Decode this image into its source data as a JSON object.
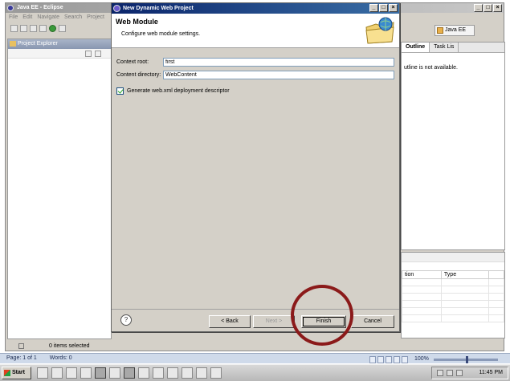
{
  "eclipse": {
    "title": "Java EE - Eclipse",
    "menu": [
      "File",
      "Edit",
      "Navigate",
      "Search",
      "Project"
    ],
    "perspective_label": "Java EE",
    "project_explorer_tab": "Project Explorer",
    "outline_tab": "Outline",
    "task_list_tab": "Task Lis",
    "outline_message": "utline is not available.",
    "problems_columns": [
      "tion",
      "Type"
    ],
    "status_text": "0 items selected",
    "window_buttons": [
      "_",
      "□",
      "×"
    ]
  },
  "dialog": {
    "title": "New Dynamic Web Project",
    "heading": "Web Module",
    "description": "Configure web module settings.",
    "fields": {
      "context_root_label": "Context root:",
      "context_root_value": "first",
      "content_directory_label": "Content directory:",
      "content_directory_value": "WebContent"
    },
    "checkbox_label": "Generate web.xml deployment descriptor",
    "checkbox_checked": true,
    "buttons": {
      "back": "< Back",
      "next": "Next >",
      "finish": "Finish",
      "cancel": "Cancel",
      "help": "?"
    },
    "window_buttons": [
      "_",
      "□",
      "×"
    ]
  },
  "word_status": {
    "page": "Page: 1 of 1",
    "words": "Words: 0",
    "zoom": "100%"
  },
  "taskbar": {
    "start_label": "Start",
    "clock": "11:45 PM"
  },
  "colors": {
    "dialog_title_bar": "#0a246a",
    "highlight_circle": "#8b1a1a",
    "checkmark": "#21a121"
  }
}
